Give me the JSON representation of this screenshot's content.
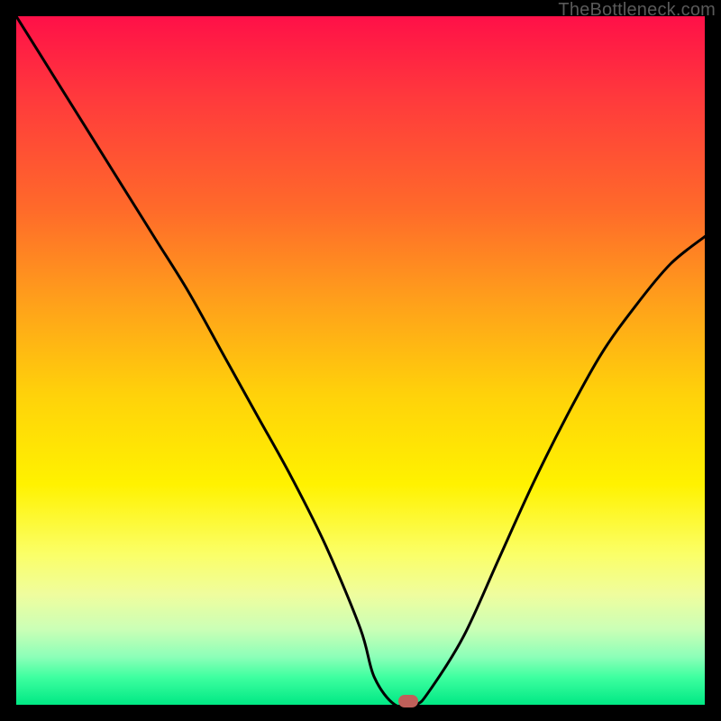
{
  "watermark": "TheBottleneck.com",
  "colors": {
    "curve_stroke": "#000000",
    "marker_fill": "#c0605a",
    "frame_bg": "#000000"
  },
  "chart_data": {
    "type": "line",
    "title": "",
    "xlabel": "",
    "ylabel": "",
    "xlim": [
      0,
      100
    ],
    "ylim": [
      0,
      100
    ],
    "grid": false,
    "legend": false,
    "series": [
      {
        "name": "bottleneck-curve",
        "x": [
          0,
          5,
          10,
          15,
          20,
          25,
          30,
          35,
          40,
          45,
          50,
          52,
          55,
          58,
          60,
          65,
          70,
          75,
          80,
          85,
          90,
          95,
          100
        ],
        "y": [
          100,
          92,
          84,
          76,
          68,
          60,
          51,
          42,
          33,
          23,
          11,
          4,
          0,
          0,
          2,
          10,
          21,
          32,
          42,
          51,
          58,
          64,
          68
        ]
      }
    ],
    "marker": {
      "x": 57,
      "y": 0
    },
    "background_gradient": {
      "orientation": "vertical",
      "stops": [
        {
          "pos": 0.0,
          "color": "#ff1048"
        },
        {
          "pos": 0.12,
          "color": "#ff3a3c"
        },
        {
          "pos": 0.28,
          "color": "#ff6a2a"
        },
        {
          "pos": 0.42,
          "color": "#ffa21a"
        },
        {
          "pos": 0.55,
          "color": "#ffd20a"
        },
        {
          "pos": 0.68,
          "color": "#fff200"
        },
        {
          "pos": 0.78,
          "color": "#fbff66"
        },
        {
          "pos": 0.84,
          "color": "#effd9e"
        },
        {
          "pos": 0.89,
          "color": "#cbffb6"
        },
        {
          "pos": 0.93,
          "color": "#8dffb8"
        },
        {
          "pos": 0.96,
          "color": "#3effa0"
        },
        {
          "pos": 1.0,
          "color": "#00e884"
        }
      ]
    }
  }
}
